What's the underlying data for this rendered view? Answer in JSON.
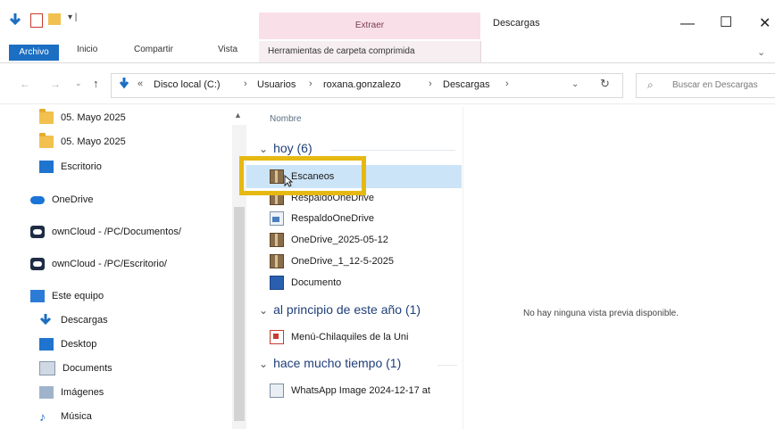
{
  "ribbon": {
    "file_tab": "Archivo",
    "tabs": [
      "Inicio",
      "Compartir",
      "Vista"
    ],
    "context_header": "Extraer",
    "context_tab": "Herramientas de carpeta comprimida"
  },
  "window": {
    "title": "Descargas",
    "minimize": "—",
    "maximize": "☐",
    "close": "✕",
    "expand_ribbon": "⌄"
  },
  "address": {
    "crumbs": [
      "Disco local (C:)",
      "Usuarios",
      "roxana.gonzalezo",
      "Descargas"
    ],
    "search_placeholder": "Buscar en Descargas"
  },
  "sidebar": {
    "items": [
      {
        "label": "05. Mayo 2025",
        "icon": "folder-icon"
      },
      {
        "label": "05. Mayo 2025",
        "icon": "folder-icon"
      },
      {
        "label": "Escritorio",
        "icon": "desktop-icon"
      },
      {
        "label": "OneDrive",
        "icon": "cloud-icon"
      },
      {
        "label": "ownCloud - /PC/Documentos/",
        "icon": "owncloud-icon"
      },
      {
        "label": "ownCloud - /PC/Escritorio/",
        "icon": "owncloud-icon"
      },
      {
        "label": "Este equipo",
        "icon": "pc-icon"
      },
      {
        "label": "Descargas",
        "icon": "download-icon"
      },
      {
        "label": "Desktop",
        "icon": "desktop-icon"
      },
      {
        "label": "Documents",
        "icon": "documents-icon"
      },
      {
        "label": "Imágenes",
        "icon": "pictures-icon"
      },
      {
        "label": "Música",
        "icon": "music-icon"
      }
    ]
  },
  "filelist": {
    "column_name": "Nombre",
    "groups": [
      {
        "label": "hoy (6)"
      },
      {
        "label": "al principio de este año (1)"
      },
      {
        "label": "hace mucho tiempo (1)"
      }
    ],
    "files": [
      {
        "name": "Escaneos",
        "icon": "zip-icon"
      },
      {
        "name": "RespaldoOneDrive",
        "icon": "zip-icon"
      },
      {
        "name": "RespaldoOneDrive",
        "icon": "file-icon"
      },
      {
        "name": "OneDrive_2025-05-12",
        "icon": "zip-icon"
      },
      {
        "name": "OneDrive_1_12-5-2025",
        "icon": "zip-icon"
      },
      {
        "name": "Documento",
        "icon": "word-icon"
      },
      {
        "name": "Menú-Chilaquiles de la Uni",
        "icon": "pdf-icon"
      },
      {
        "name": "WhatsApp Image 2024-12-17 at",
        "icon": "image-icon"
      }
    ]
  },
  "preview": {
    "message": "No hay ninguna vista previa disponible."
  },
  "colors": {
    "accent": "#1b6ec2",
    "selection": "#cce4f7",
    "highlight_box": "#e5b912",
    "context_tab": "#f9dfe8"
  }
}
